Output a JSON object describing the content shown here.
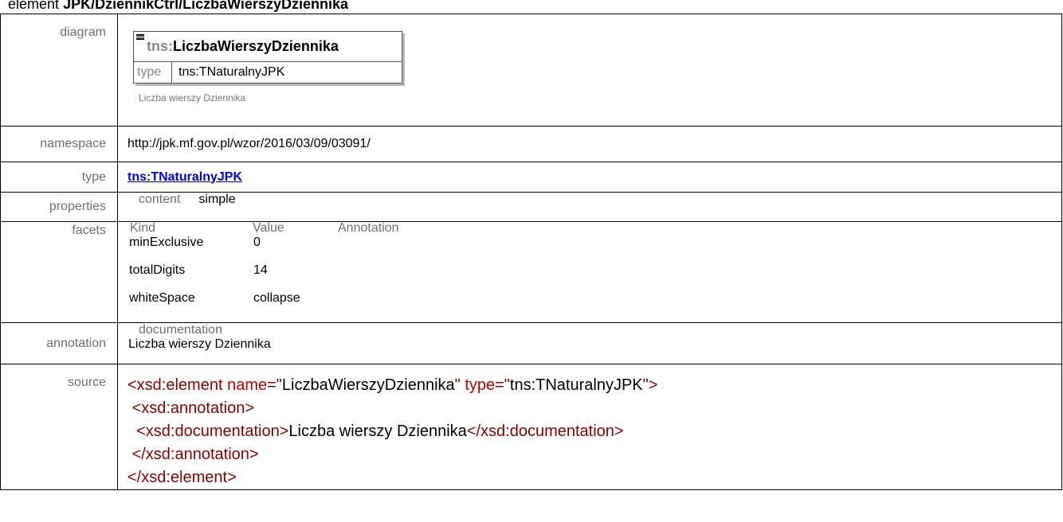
{
  "heading": {
    "prefix": "element",
    "path": "JPK/DziennikCtrl/LiczbaWierszyDziennika"
  },
  "rows": {
    "diagram": {
      "label": "diagram",
      "element_ns": "tns:",
      "element_name": "LiczbaWierszyDziennika",
      "type_label": "type",
      "type_value": "tns:TNaturalnyJPK",
      "note": "Liczba wierszy Dziennika"
    },
    "namespace": {
      "label": "namespace",
      "value": "http://jpk.mf.gov.pl/wzor/2016/03/09/03091/"
    },
    "type": {
      "label": "type",
      "value": "tns:TNaturalnyJPK"
    },
    "properties": {
      "label": "properties",
      "key": "content",
      "value": "simple"
    },
    "facets": {
      "label": "facets",
      "headers": [
        "Kind",
        "Value",
        "Annotation"
      ],
      "items": [
        {
          "kind": "minExclusive",
          "value": "0"
        },
        {
          "kind": "totalDigits",
          "value": "14"
        },
        {
          "kind": "whiteSpace",
          "value": "collapse"
        }
      ]
    },
    "annotation": {
      "label": "annotation",
      "key": "documentation",
      "value": "Liczba wierszy Dziennika"
    },
    "source": {
      "label": "source",
      "lines": {
        "l1_open": "<xsd:element",
        "l1_attr1": "name",
        "l1_eq1": "=\"",
        "l1_val1": "LiczbaWierszyDziennika",
        "l1_q1": "\"",
        "l1_attr2": "type",
        "l1_eq2": "=\"",
        "l1_val2": "tns:TNaturalnyJPK",
        "l1_close": "\">",
        "l2": "<xsd:annotation>",
        "l3_open": "<xsd:documentation>",
        "l3_text": "Liczba wierszy Dziennika",
        "l3_close": "</xsd:documentation>",
        "l4": "</xsd:annotation>",
        "l5": "</xsd:element>"
      }
    }
  }
}
